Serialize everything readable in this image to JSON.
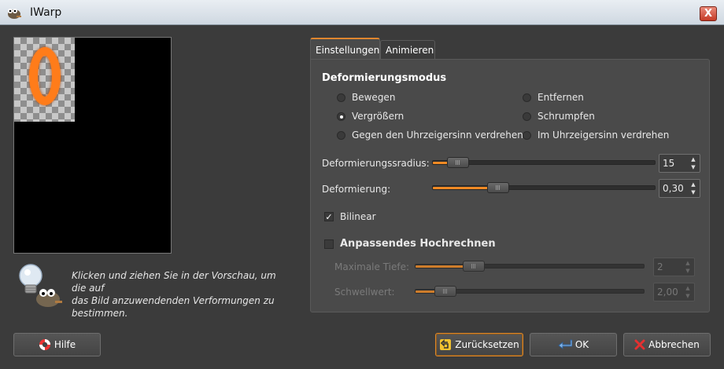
{
  "window": {
    "title": "IWarp",
    "close_label": "X"
  },
  "hint": {
    "text": "Klicken und ziehen Sie in der Vorschau, um die auf\ndas Bild anzuwendenden Verformungen zu\nbestimmen."
  },
  "tabs": [
    {
      "label": "Einstellungen",
      "active": true
    },
    {
      "label": "Animieren",
      "active": false
    }
  ],
  "settings": {
    "mode_title": "Deformierungsmodus",
    "modes": [
      {
        "label": "Bewegen",
        "selected": false
      },
      {
        "label": "Entfernen",
        "selected": false
      },
      {
        "label": "Vergrößern",
        "selected": true
      },
      {
        "label": "Schrumpfen",
        "selected": false
      },
      {
        "label": "Gegen den Uhrzeigersinn verdrehen",
        "selected": false
      },
      {
        "label": "Im Uhrzeigersinn verdrehen",
        "selected": false
      }
    ],
    "radius": {
      "label": "Deformierungssradius:",
      "value": "15",
      "level": 0.07
    },
    "amount": {
      "label": "Deformierung:",
      "value": "0,30",
      "level": 0.27
    },
    "bilinear": {
      "label": "Bilinear",
      "checked": true
    },
    "supersampling": {
      "label": "Anpassendes Hochrechnen",
      "checked": false,
      "max_depth": {
        "label": "Maximale Tiefe:",
        "value": "2",
        "level": 0.23
      },
      "threshold": {
        "label": "Schwellwert:",
        "value": "2,00",
        "level": 0.09
      }
    }
  },
  "buttons": {
    "help": "Hilfe",
    "reset": "Zurücksetzen",
    "ok": "OK",
    "cancel": "Abbrechen"
  },
  "colors": {
    "accent": "#f08a24",
    "background": "#3b3b3b",
    "panel": "#4a4a4a"
  }
}
